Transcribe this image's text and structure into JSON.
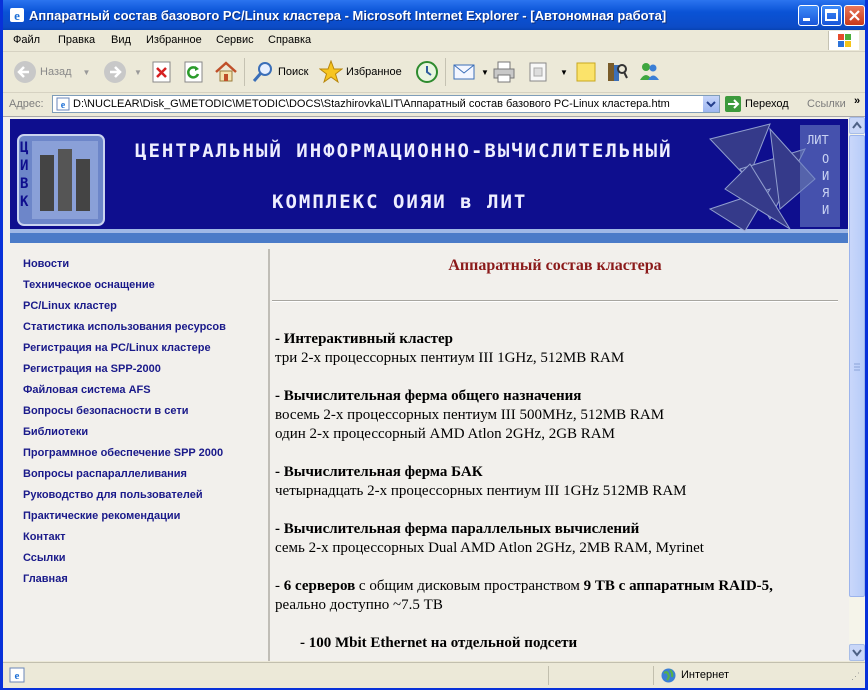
{
  "window": {
    "title": "Аппаратный состав базового PC/Linux кластера - Microsoft Internet Explorer - [Автономная работа]"
  },
  "menu": [
    "Файл",
    "Правка",
    "Вид",
    "Избранное",
    "Сервис",
    "Справка"
  ],
  "toolbar": {
    "back": "Назад",
    "search": "Поиск",
    "favorites": "Избранное"
  },
  "address": {
    "label": "Адрес:",
    "url": "D:\\NUCLEAR\\Disk_G\\METODIC\\METODIC\\DOCS\\Stazhirovka\\LIT\\Аппаратный состав базового PC-Linux кластера.htm",
    "go": "Переход",
    "links": "Ссылки"
  },
  "banner": {
    "line1": "ЦЕНТРАЛЬНЫЙ ИНФОРМАЦИОННО-ВЫЧИСЛИТЕЛЬНЫЙ",
    "line2": "КОМПЛЕКС ОИЯИ в ЛИТ",
    "logo_left": [
      "Ц",
      "И",
      "В",
      "К"
    ],
    "logo_right_top": "ЛИТ",
    "logo_right_side": [
      "О",
      "И",
      "Я",
      "И"
    ]
  },
  "nav": [
    "Новости",
    "Техническое оснащение",
    "PC/Linux кластер",
    "Статистика использования ресурсов",
    "Регистрация на PC/Linux кластере",
    "Регистрация на SPP-2000",
    "Файловая система AFS",
    "Вопросы безопасности в сети",
    "Библиотеки",
    "Программное обеспечение SPP 2000",
    "Вопросы распараллеливания",
    "Руководство для пользователей",
    "Практические рекомендации",
    "Контакт",
    "Ссылки",
    "Главная"
  ],
  "main": {
    "heading": "Аппаратный состав кластера",
    "s1_title": "- Интерактивный кластер",
    "s1_l1": "три 2-х процессорных пентиум III 1GHz, 512MB RAM",
    "s2_title": "- Вычислительная ферма общего назначения",
    "s2_l1": "восемь  2-х процессорных пентиум III 500MHz, 512MB RAM",
    "s2_l2": "один 2-х процессорный AMD Atlon 2GHz, 2GB RAM",
    "s3_title": "- Вычислительная ферма БАК",
    "s3_l1": "четырнадцать  2-х процессорных пентиум III 1GHz 512MB RAM",
    "s4_title": "- Вычислительная ферма параллельных вычислений",
    "s4_l1": "семь  2-х процессорных Dual AMD Atlon 2GHz, 2MB RAM, Myrinet",
    "s5_a": "- ",
    "s5_b": "6 серверов",
    "s5_c": " с общим дисковым пространством ",
    "s5_d": "9 ТВ с аппаратным RAID-5,",
    "s5_l2": "реально доступно ~7.5 ТВ",
    "s6": "- 100 Mbit Ethernet на отдельной подсети"
  },
  "status": {
    "zone": "Интернет"
  },
  "colors": {
    "title_blue": "#0a53d6",
    "banner_navy": "#0e0e8e",
    "nav_link": "#1a1a8a",
    "heading_red": "#8b1a1a"
  }
}
